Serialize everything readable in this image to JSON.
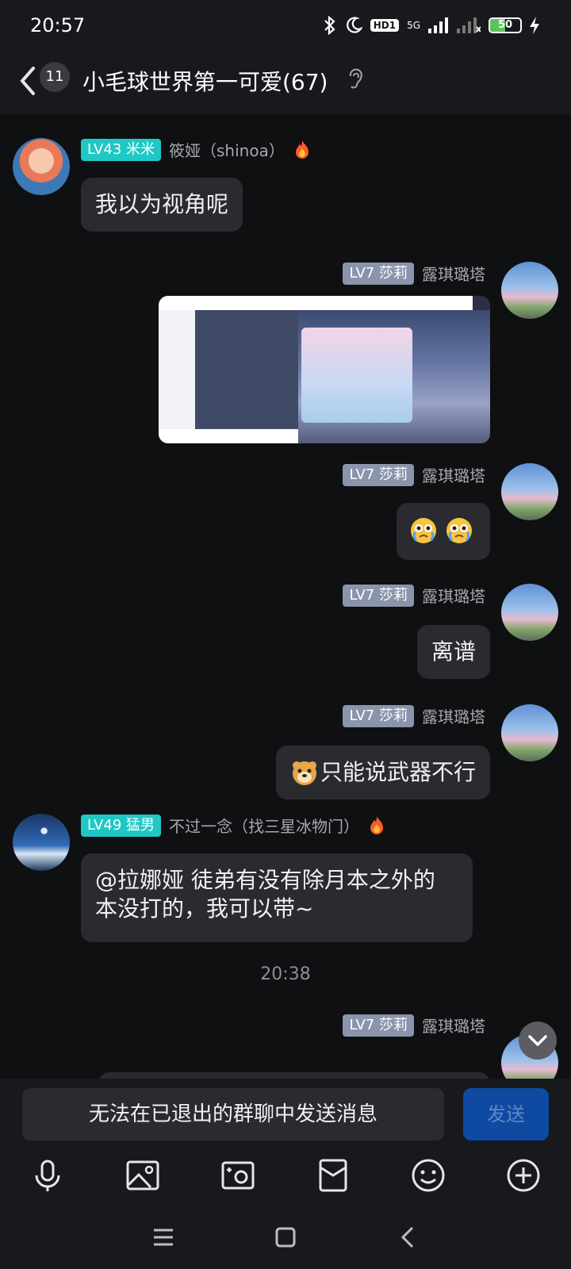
{
  "status_bar": {
    "time": "20:57",
    "hd": "HD1",
    "network": "5G",
    "battery_level": 50,
    "battery_label": "50"
  },
  "header": {
    "unread_count": "11",
    "title": "小毛球世界第一可爱(67)"
  },
  "messages": [
    {
      "side": "left",
      "level": "LV43",
      "title": "米米",
      "nickname": "筱娅（shinoa）",
      "text": "我以为视角呢"
    },
    {
      "side": "right",
      "level": "LV7",
      "title": "莎莉",
      "nickname": "露琪璐塔",
      "type": "image"
    },
    {
      "side": "right",
      "level": "LV7",
      "title": "莎莉",
      "nickname": "露琪璐塔",
      "type": "emoji"
    },
    {
      "side": "right",
      "level": "LV7",
      "title": "莎莉",
      "nickname": "露琪璐塔",
      "text": "离谱"
    },
    {
      "side": "right",
      "level": "LV7",
      "title": "莎莉",
      "nickname": "露琪璐塔",
      "text": "只能说武器不行"
    },
    {
      "side": "left",
      "level": "LV49",
      "title": "猛男",
      "nickname": "不过一念（找三星冰物门）",
      "text_line1": "@拉娜娅 徒弟有没有除月本之外的",
      "text_line2": "本没打的，我可以带~"
    },
    {
      "side": "right",
      "level": "LV7",
      "title": "莎莉",
      "nickname": "露琪璐塔"
    }
  ],
  "timestamp": "20:38",
  "input": {
    "placeholder": "无法在已退出的群聊中发送消息",
    "send_label": "发送"
  },
  "toolbar_icons": [
    "microphone-icon",
    "photo-icon",
    "camera-icon",
    "red-packet-icon",
    "emoji-icon",
    "plus-icon"
  ],
  "colors": {
    "background": "#0f1012",
    "bubble": "#2a2b2f",
    "level_teal": "#1fc8c4",
    "level_gray": "#8a94ab",
    "send_button": "#0f4aa2"
  }
}
